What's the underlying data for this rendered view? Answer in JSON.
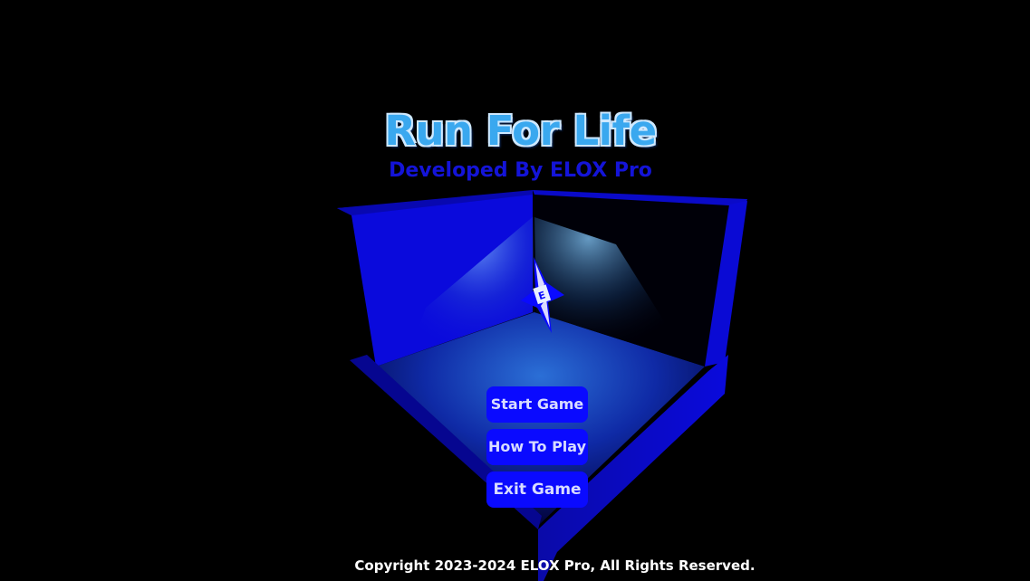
{
  "game": {
    "title": "Run For Life",
    "subtitle": "Developed By ELOX Pro",
    "emblem_letter": "E"
  },
  "menu": {
    "start_label": "Start Game",
    "how_to_label": "How To Play",
    "exit_label": "Exit Game"
  },
  "footer": {
    "copyright": "Copyright 2023-2024 ELOX Pro, All Rights Reserved."
  },
  "colors": {
    "background": "#000000",
    "wall": "#0a0adc",
    "button": "#0a0aff",
    "title": "#3aa8ef",
    "subtitle": "#1414d8"
  }
}
